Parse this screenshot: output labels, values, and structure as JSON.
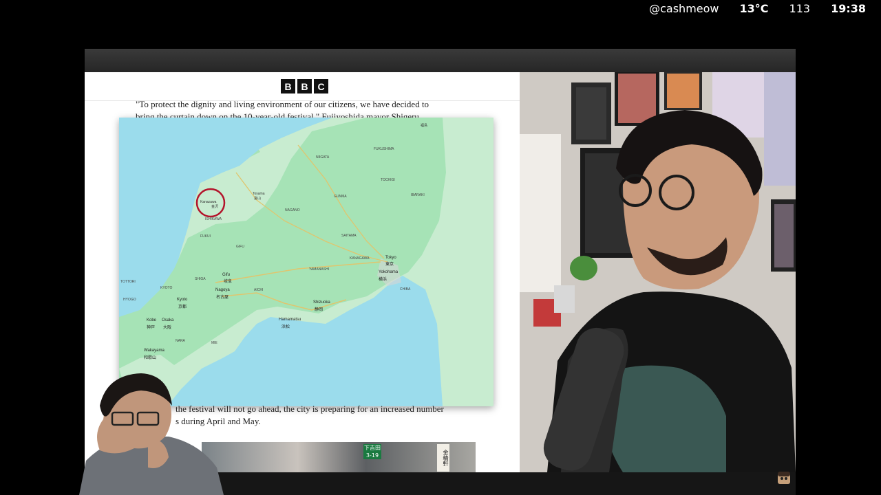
{
  "hud": {
    "handle": "@cashmeow",
    "temperature": "13°C",
    "count": "113",
    "time": "19:38"
  },
  "article": {
    "logo_letters": [
      "B",
      "B",
      "C"
    ],
    "para1_line1": "\"To protect the dignity and living environment of our citizens, we have decided to",
    "para1_line2": "bring the curtain down on the 10-year-old festival,\" Fujiyoshida mayor Shigeru",
    "para2_line1": "the festival will not go ahead, the city is preparing for an increased number",
    "para2_line2": "s during April and May."
  },
  "map": {
    "labels": [
      "Kanazawa",
      "金沢",
      "Toyama",
      "富山",
      "NIIGATA",
      "FUKUSHIMA",
      "TOCHIGI",
      "IBARAKI",
      "GUNMA",
      "NAGANO",
      "SAITAMA",
      "GIFU",
      "ISHIKAWA",
      "FUKUI",
      "Tokyo",
      "東京",
      "Yokohama",
      "横浜",
      "KANAGAWA",
      "YAMANASHI",
      "CHIBA",
      "Gifu",
      "岐阜",
      "Nagoya",
      "名古屋",
      "Shizuoka",
      "静岡",
      "Hamamatsu",
      "浜松",
      "Kyoto",
      "京都",
      "Osaka",
      "大阪",
      "Kobe",
      "神戸",
      "Wakayama",
      "和歌山",
      "SHIGA",
      "KYOTO",
      "HYOGO",
      "NARA",
      "MIE",
      "AICHI",
      "TOTTORI",
      "福島"
    ]
  },
  "photo": {
    "sign_number": "3-19",
    "sign_top": "下吉田",
    "sign_vertical": "金精軒"
  }
}
